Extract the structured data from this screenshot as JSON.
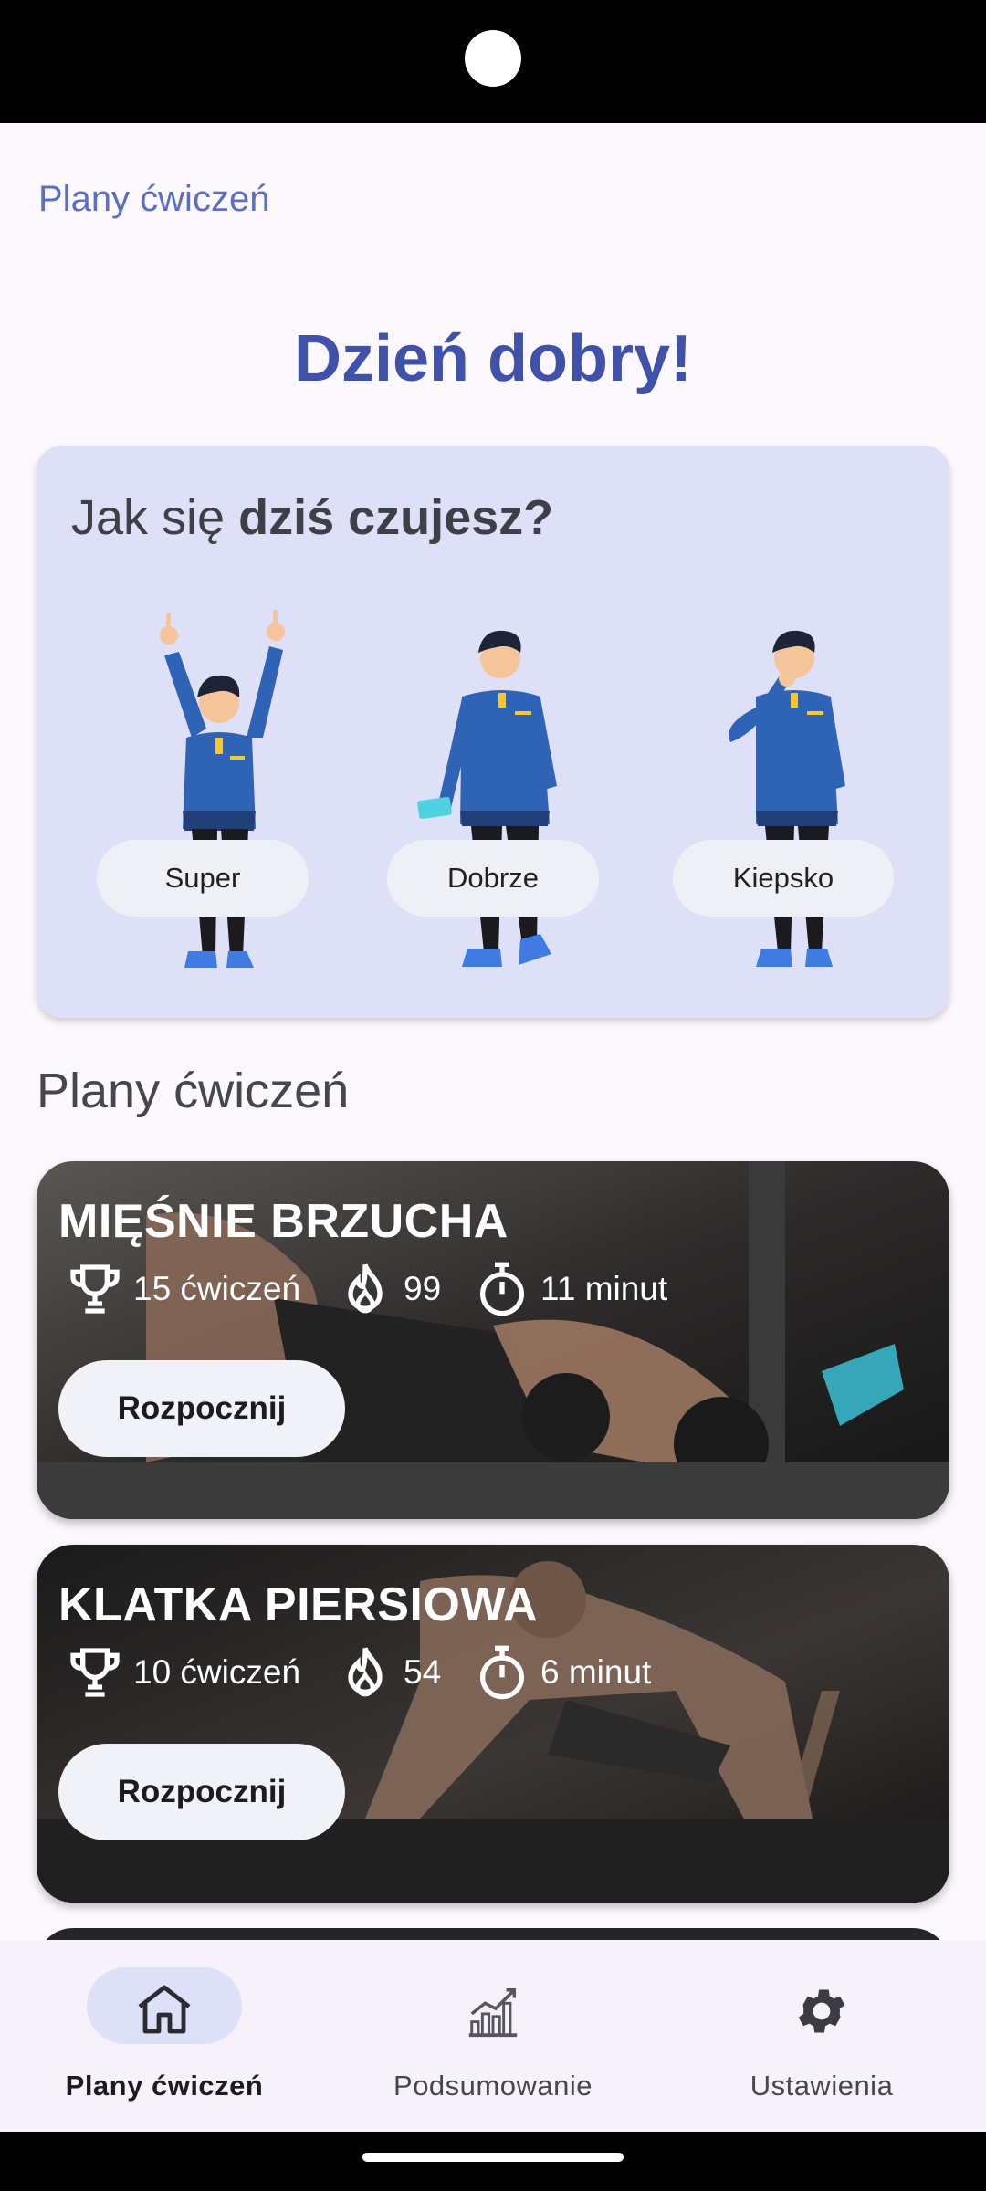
{
  "app_bar": {
    "title": "Plany ćwiczeń"
  },
  "greeting": "Dzień dobry!",
  "mood": {
    "question_prefix": "Jak się ",
    "question_bold": "dziś czujesz?",
    "options": [
      {
        "label": "Super"
      },
      {
        "label": "Dobrze"
      },
      {
        "label": "Kiepsko"
      }
    ]
  },
  "plans_section": {
    "title": "Plany ćwiczeń"
  },
  "plans": [
    {
      "title": "MIĘŚNIE BRZUCHA",
      "exercises": "15 ćwiczeń",
      "calories": "99",
      "duration": "11 minut",
      "start_label": "Rozpocznij"
    },
    {
      "title": "KLATKA PIERSIOWA",
      "exercises": "10 ćwiczeń",
      "calories": "54",
      "duration": "6 minut",
      "start_label": "Rozpocznij"
    }
  ],
  "bottom_nav": {
    "items": [
      {
        "label": "Plany ćwiczeń",
        "icon": "home-icon",
        "active": true
      },
      {
        "label": "Podsumowanie",
        "icon": "chart-icon",
        "active": false
      },
      {
        "label": "Ustawienia",
        "icon": "gear-icon",
        "active": false
      }
    ]
  },
  "colors": {
    "primary": "#3f51a8",
    "title_accent": "#5b6fc4",
    "mood_card": "#dde0f7",
    "nav_active_pill": "#dde1f8",
    "shirt_blue": "#2f63b5"
  }
}
